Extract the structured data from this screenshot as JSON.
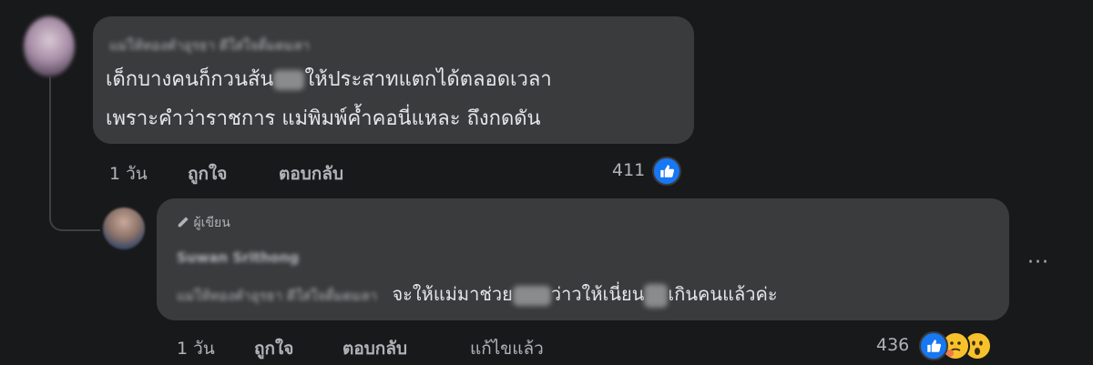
{
  "comment": {
    "author": "แม่ให้ทองคำอุรธา ดีใส่ใจดื่มดมลา",
    "line1": "เด็กบางคนก็กวนส้น",
    "line1_rest": "ให้ประสาทแตกได้ตลอดเวลา",
    "line2": "เพราะคำว่าราชการ แม่พิมพ์ค้ำคอนี่แหละ ถึงกดดัน",
    "time": "1 วัน",
    "like_label": "ถูกใจ",
    "reply_label": "ตอบกลับ",
    "reaction_count": "411"
  },
  "reply": {
    "author_badge": "ผู้เขียน",
    "author": "Suwan Srithong",
    "mention": "แม่ให้ทองคำอุรธา ดีใส่ใจดื่มดมลา",
    "text_a": "จะให้แม่มาช่วย",
    "text_b": "ว่าวให้เนี่ยน",
    "text_c": "เกินคนแล้วค่ะ",
    "time": "1 วัน",
    "like_label": "ถูกใจ",
    "reply_label": "ตอบกลับ",
    "edited_label": "แก้ไขแล้ว",
    "reaction_count": "436",
    "more_label": "···"
  },
  "colors": {
    "background": "#18191a",
    "bubble": "#3a3b3c",
    "text": "#e4e6eb",
    "secondary": "#b0b3b8",
    "like_blue": "#1877f2"
  }
}
